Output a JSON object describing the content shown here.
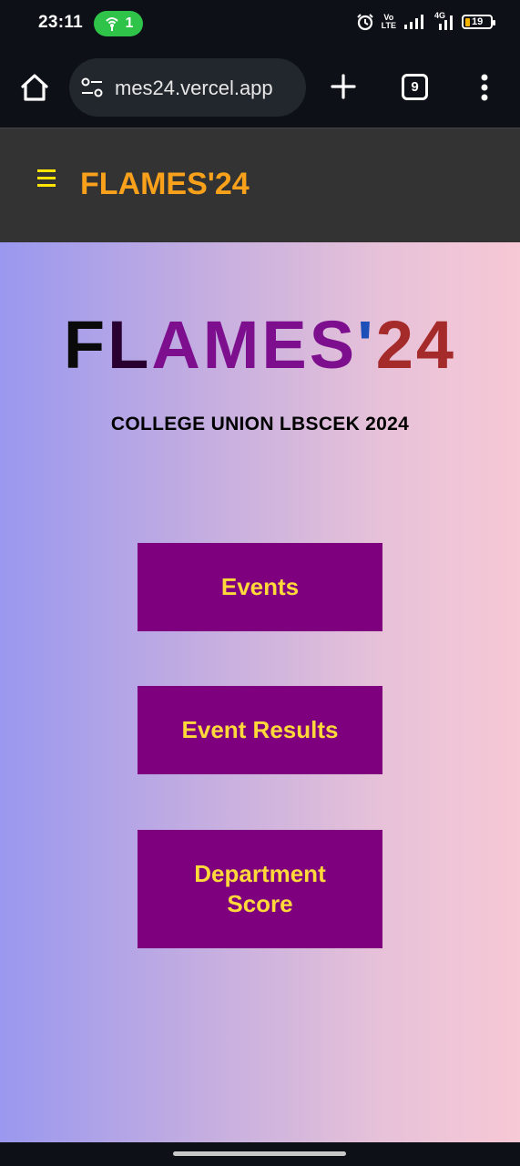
{
  "status_bar": {
    "time": "23:11",
    "hotspot_count": "1",
    "volte_label_top": "Vo",
    "volte_label_bottom": "LTE",
    "network_type": "4G",
    "battery_level": "19"
  },
  "browser": {
    "url": "mes24.vercel.app",
    "tab_count": "9",
    "icons": [
      "home-icon",
      "site-settings-icon",
      "plus-icon",
      "tabs-icon",
      "more-vert-icon"
    ]
  },
  "site_header": {
    "brand": "FLAMES'24"
  },
  "hero": {
    "title_parts": [
      "F",
      "L",
      "AMES",
      "'",
      "24"
    ],
    "subtitle": "COLLEGE UNION LBSCEK 2024"
  },
  "nav_buttons": {
    "events": "Events",
    "event_results": "Event Results",
    "department_score": "Department Score"
  },
  "colors": {
    "header_bg": "#333333",
    "brand": "#f9a11b",
    "button_bg": "#7f007f",
    "button_text": "#ffd93a"
  }
}
